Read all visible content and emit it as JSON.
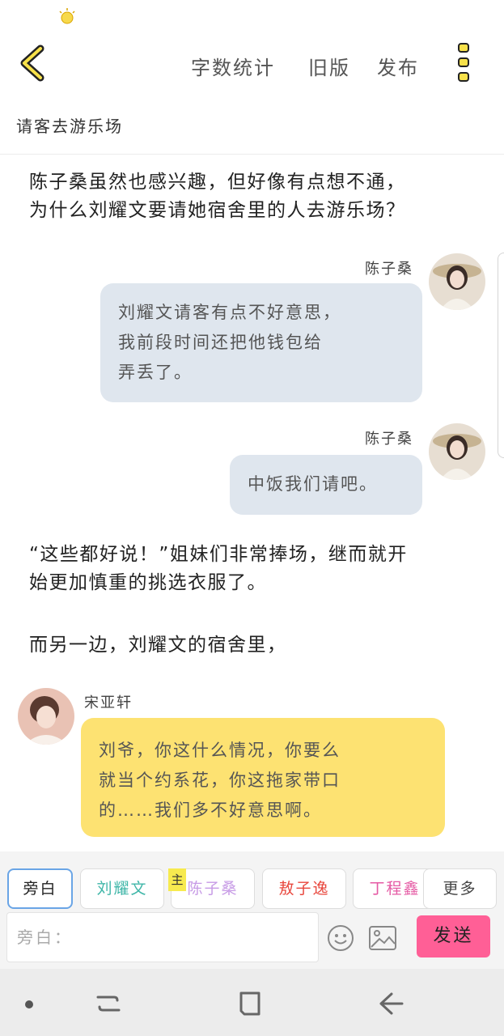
{
  "header": {
    "actions": [
      "字数统计",
      "旧版",
      "发布"
    ]
  },
  "chapter_title": "请客去游乐场",
  "story": {
    "narration_1": [
      "陈子桑虽然也感兴趣，但好像有点想不通，",
      "为什么刘耀文要请她宿舍里的人去游乐场？"
    ],
    "message_1": {
      "name": "陈子桑",
      "lines": [
        "刘耀文请客有点不好意思，",
        "我前段时间还把他钱包给",
        "弄丢了。"
      ]
    },
    "message_2": {
      "name": "陈子桑",
      "lines": [
        "中饭我们请吧。"
      ]
    },
    "narration_2": [
      "“这些都好说！”姐妹们非常捧场，继而就开",
      "始更加慎重的挑选衣服了。"
    ],
    "narration_3": "而另一边，刘耀文的宿舍里，",
    "message_3": {
      "name": "宋亚轩",
      "lines": [
        "刘爷，你这什么情况，你要么",
        "就当个约系花，你这拖家带口",
        "的……我们多不好意思啊。"
      ]
    }
  },
  "composer": {
    "characters": [
      {
        "label": "旁白",
        "color": "#444444"
      },
      {
        "label": "刘耀文",
        "color": "#3fb6a8"
      },
      {
        "label": "陈子桑",
        "color": "#c79be6"
      },
      {
        "label": "敖子逸",
        "color": "#e8463c"
      },
      {
        "label": "丁程鑫",
        "color": "#e55aa4"
      },
      {
        "label": "更多",
        "color": "#444444"
      }
    ],
    "main_tag": "主",
    "input_placeholder": "旁白：",
    "send_label": "发送"
  },
  "colors": {
    "bubble_grey": "#dfe6ee",
    "bubble_yellow": "#fde272",
    "send": "#ff5f96",
    "selected_border": "#6aa5e6"
  }
}
